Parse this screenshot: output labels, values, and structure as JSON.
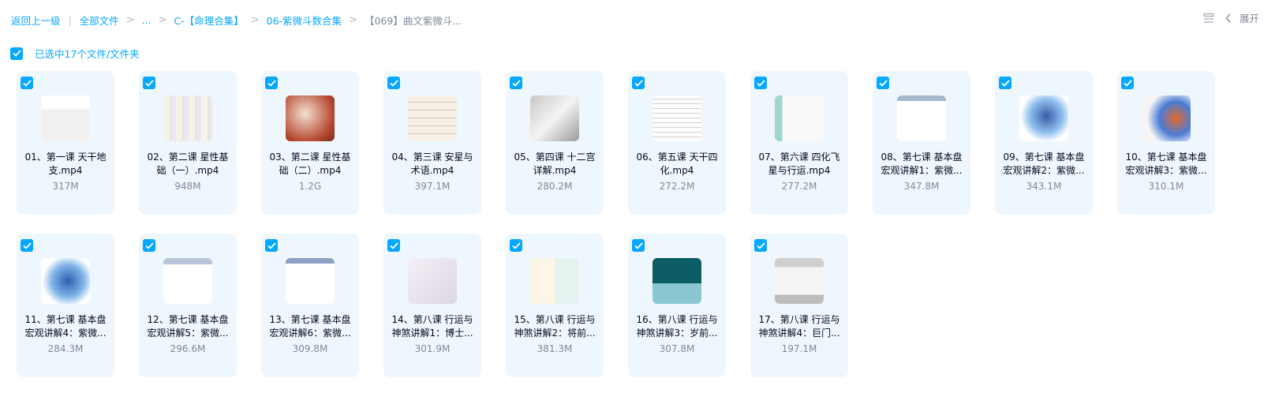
{
  "breadcrumb": {
    "back": "返回上一级",
    "items": [
      "全部文件",
      "...",
      "C-【命理合集】",
      "06-紫微斗数合集"
    ],
    "current": "【069】曲文紫微斗..."
  },
  "toolbar": {
    "expand_label": "展开",
    "icons": [
      "list-view-icon",
      "chevron-left-icon"
    ]
  },
  "selection": {
    "label": "已选中17个文件/文件夹"
  },
  "colors": {
    "accent": "#06a7ff",
    "card_bg": "#eef7fe",
    "muted": "#818999"
  },
  "files": [
    {
      "name": "01、第一课 天干地支.mp4",
      "size": "317M",
      "thumb": "video-cover-icon"
    },
    {
      "name": "02、第二课 星性基础（一）.mp4",
      "size": "948M",
      "thumb": "video-cover-icon"
    },
    {
      "name": "03、第二课 星性基础（二）.mp4",
      "size": "1.2G",
      "thumb": "video-cover-icon"
    },
    {
      "name": "04、第三课 安星与术语.mp4",
      "size": "397.1M",
      "thumb": "video-cover-icon"
    },
    {
      "name": "05、第四课 十二宫详解.mp4",
      "size": "280.2M",
      "thumb": "video-cover-icon"
    },
    {
      "name": "06、第五课 天干四化.mp4",
      "size": "272.2M",
      "thumb": "video-cover-icon"
    },
    {
      "name": "07、第六课 四化飞星与行运.mp4",
      "size": "277.2M",
      "thumb": "video-cover-icon"
    },
    {
      "name": "08、第七课 基本盘宏观讲解1：紫微...",
      "size": "347.8M",
      "thumb": "video-cover-icon"
    },
    {
      "name": "09、第七课 基本盘宏观讲解2：紫微...",
      "size": "343.1M",
      "thumb": "video-cover-icon"
    },
    {
      "name": "10、第七课 基本盘宏观讲解3：紫微...",
      "size": "310.1M",
      "thumb": "video-cover-icon"
    },
    {
      "name": "11、第七课 基本盘宏观讲解4：紫微...",
      "size": "284.3M",
      "thumb": "video-cover-icon"
    },
    {
      "name": "12、第七课 基本盘宏观讲解5：紫微...",
      "size": "296.6M",
      "thumb": "video-cover-icon"
    },
    {
      "name": "13、第七课 基本盘宏观讲解6：紫微...",
      "size": "309.8M",
      "thumb": "video-cover-icon"
    },
    {
      "name": "14、第八课 行运与神煞讲解1：博士...",
      "size": "301.9M",
      "thumb": "video-cover-icon"
    },
    {
      "name": "15、第八课 行运与神煞讲解2：将前...",
      "size": "381.3M",
      "thumb": "video-cover-icon"
    },
    {
      "name": "16、第八课 行运与神煞讲解3：岁前...",
      "size": "307.8M",
      "thumb": "video-cover-icon"
    },
    {
      "name": "17、第八课 行运与神煞讲解4：巨门...",
      "size": "197.1M",
      "thumb": "video-cover-icon"
    }
  ]
}
